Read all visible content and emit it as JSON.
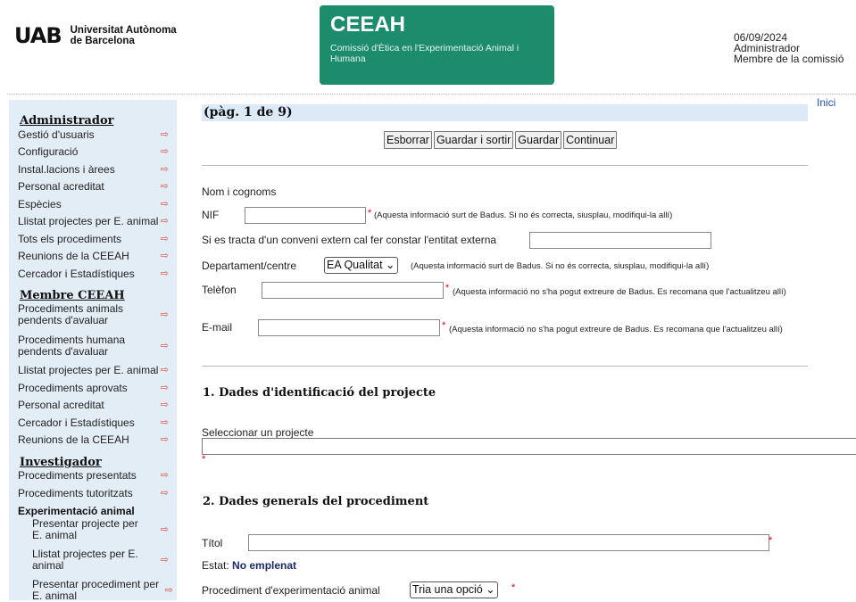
{
  "header": {
    "logo_mark": "UAB",
    "logo_line1": "Universitat Autònoma",
    "logo_line2": "de Barcelona",
    "banner_title": "CEEAH",
    "banner_subtitle": "Comissió d'Ètica en l'Experimentació Animal i Humana",
    "date": "06/09/2024",
    "user_name": "Administrador",
    "user_role": "Membre de la comissió",
    "home_link": "Inici",
    "colors": {
      "banner": "#1c8c6d",
      "sidebar": "#e3edf6",
      "pagebar": "#dce9f7",
      "required": "#dd0000",
      "arrow": "#d9534f"
    }
  },
  "sidebar": {
    "admin_title": "Administrador",
    "admin_items": [
      "Gestió d'usuaris",
      "Configuració",
      "Instal.lacions i àrees",
      "Personal acreditat",
      "Espècies",
      "Llistat projectes per E. animal",
      "Tots els procediments",
      "Reunions de la CEEAH",
      "Cercador i Estadístiques"
    ],
    "member_title": "Membre CEEAH",
    "member_items": [
      "Procediments animals pendents d'avaluar",
      "Procediments humana pendents d'avaluar",
      "Llistat projectes per E. animal",
      "Procediments aprovats",
      "Personal acreditat",
      "Cercador i Estadístiques",
      "Reunions de la CEEAH"
    ],
    "investigator_title": "Investigador",
    "investigator_items": [
      "Procediments presentats",
      "Procediments tutoritzats"
    ],
    "experimentation_title": "Experimentació animal",
    "experimentation_items": [
      "Presentar projecte per E. animal",
      "Llistat projectes per E. animal",
      "Presentar procediment per E. animal"
    ],
    "arrow_icon": "logout-arrow-icon"
  },
  "main": {
    "page_label": "(pàg. 1 de 9)",
    "buttons": {
      "delete": "Esborrar",
      "save_exit": "Guardar i sortir",
      "save": "Guardar",
      "continue": "Continuar"
    },
    "name_label": "Nom i cognoms",
    "nif_label": "NIF",
    "nif_note": "(Aquesta informació surt de Badus. Si no és correcta, siusplau, modifiqui-la allí)",
    "external_label": "Si es tracta d'un conveni extern cal fer constar l'entitat externa",
    "dept_label": "Departament/centre",
    "dept_value": "EA Qualitat",
    "dept_note": "(Aquesta informació surt de Badus. Si no és correcta, siusplau, modifiqui-la allí)",
    "phone_label": "Telèfon",
    "phone_note": "(Aquesta informació no s'ha pogut extreure de Badus. Es recomana que l'actualitzeu allí)",
    "email_label": "E-mail",
    "email_note": "(Aquesta informació no s'ha pogut extreure de Badus. Es recomana que l'actualitzeu allí)",
    "section1_title": "1. Dades d'identificació del projecte",
    "select_project_label": "Seleccionar un projecte",
    "section2_title": "2. Dades generals del procediment",
    "title_label": "Títol",
    "status_label": "Estat:",
    "status_value": "No emplenat",
    "procedure_label": "Procediment d'experimentació animal",
    "procedure_value": "Tria una opció",
    "required_mark": "*"
  }
}
